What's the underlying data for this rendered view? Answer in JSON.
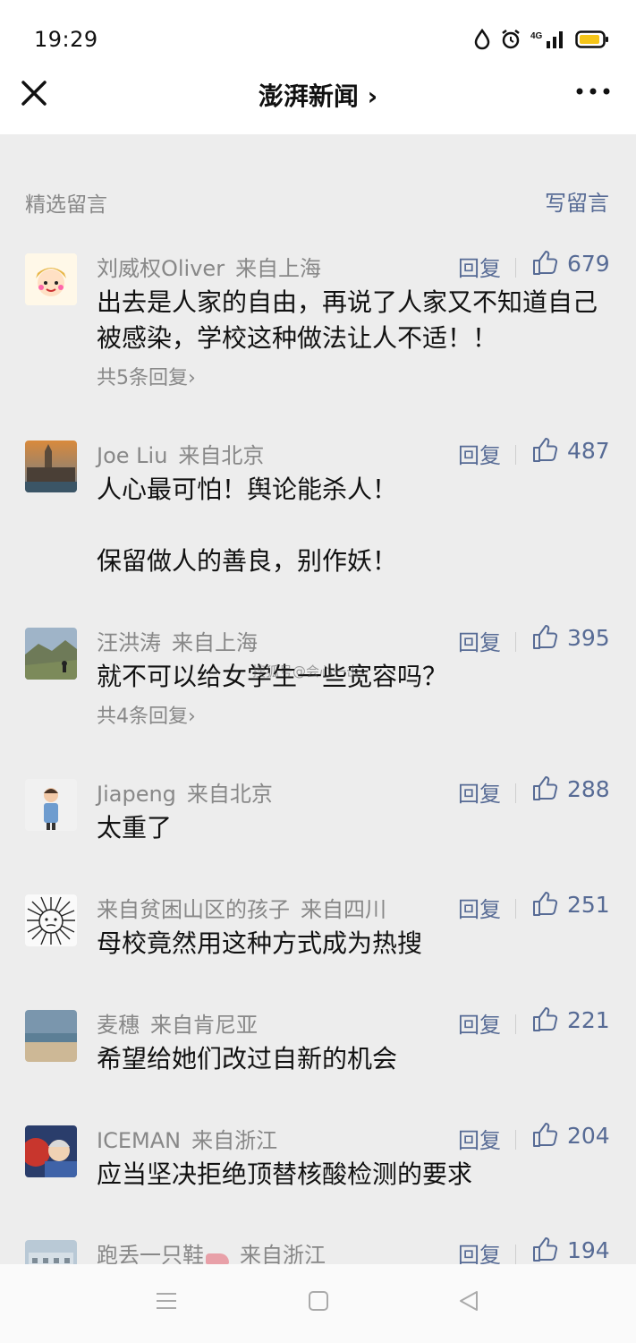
{
  "status": {
    "time": "19:29",
    "signal_text": "4G"
  },
  "nav": {
    "title": "澎湃新闻 ›"
  },
  "section": {
    "title": "精选留言",
    "write_label": "写留言"
  },
  "reply_label": "回复",
  "colors": {
    "link": "#576b95",
    "background": "#ededed",
    "battery": "#f5c518"
  },
  "comments": [
    {
      "name": "刘威权Oliver",
      "location": "来自上海",
      "likes": "679",
      "lines": [
        "出去是人家的自由，再说了人家又不知道自己被感染，学校这种做法让人不适！！"
      ],
      "replies": "共5条回复›"
    },
    {
      "name": "Joe Liu",
      "location": "来自北京",
      "likes": "487",
      "lines": [
        "人心最可怕！舆论能杀人！",
        "保留做人的善良，别作妖！"
      ]
    },
    {
      "name": "汪洪涛",
      "location": "来自上海",
      "likes": "395",
      "lines": [
        "就不可以给女学生一些宽容吗？"
      ],
      "replies": "共4条回复›"
    },
    {
      "name": "Jiapeng",
      "location": "来自北京",
      "likes": "288",
      "lines": [
        "太重了"
      ]
    },
    {
      "name": "来自贫困山区的孩子",
      "location": "来自四川",
      "likes": "251",
      "lines": [
        "母校竟然用这种方式成为热搜"
      ]
    },
    {
      "name": "麦穗",
      "location": "来自肯尼亚",
      "likes": "221",
      "lines": [
        "希望给她们改过自新的机会"
      ]
    },
    {
      "name": "ICEMAN",
      "location": "来自浙江",
      "likes": "204",
      "lines": [
        "应当坚决拒绝顶替核酸检测的要求"
      ]
    },
    {
      "name": "跑丢一只鞋",
      "location": "来自浙江",
      "likes": "194",
      "lines": []
    }
  ],
  "watermark": "搜狐号@会心一击"
}
